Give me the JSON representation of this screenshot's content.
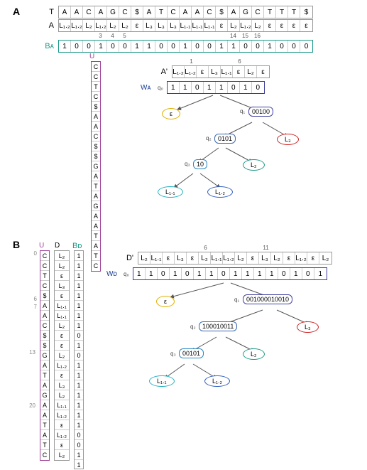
{
  "panelA": {
    "label": "A",
    "rows": {
      "T": {
        "label": "T",
        "cells": [
          "A",
          "A",
          "C",
          "A",
          "G",
          "C",
          "$",
          "A",
          "T",
          "C",
          "A",
          "A",
          "C",
          "$",
          "A",
          "G",
          "C",
          "T",
          "T",
          "T",
          "$"
        ]
      },
      "A": {
        "label": "A",
        "cells": [
          "L₁.₂",
          "L₁.₂",
          "L₂",
          "L₁.₂",
          "L₂",
          "L₂",
          "ε",
          "L₃",
          "L₃",
          "L₃",
          "L₁.₁",
          "L₁.₁",
          "L₁.₁",
          "ε",
          "L₂",
          "L₁.₂",
          "L₂",
          "ε",
          "ε",
          "ε",
          "ε"
        ]
      },
      "BA": {
        "label": "Bᴀ",
        "indices_top": [
          "",
          "",
          "",
          "3",
          "4",
          "5",
          "",
          "",
          "",
          "",
          "",
          "",
          "",
          "",
          "14",
          "15",
          "16",
          "",
          "",
          "",
          ""
        ],
        "cells": [
          "1",
          "0",
          "0",
          "1",
          "0",
          "0",
          "1",
          "1",
          "0",
          "0",
          "1",
          "0",
          "0",
          "1",
          "1",
          "0",
          "0",
          "1",
          "0",
          "0",
          "0"
        ]
      }
    },
    "U": {
      "label": "U",
      "cells": [
        "C",
        "C",
        "T",
        "C",
        "$",
        "A",
        "A",
        "C",
        "$",
        "$",
        "G",
        "A",
        "T",
        "A",
        "G",
        "A",
        "A",
        "T",
        "A",
        "T",
        "C"
      ]
    },
    "Aprime": {
      "label": "A'",
      "indices": [
        "",
        "1",
        "",
        "",
        "",
        "6",
        "",
        ""
      ],
      "cells": [
        "L₁.₂",
        "L₁.₂",
        "ε",
        "L₃",
        "L₁.₁",
        "ε",
        "L₂",
        "ε"
      ]
    },
    "WA": {
      "label": "Wᴀ",
      "cells": [
        "1",
        "1",
        "0",
        "1",
        "1",
        "0",
        "1",
        "0"
      ]
    },
    "tree": {
      "q0": "q₀",
      "q1": "q₁",
      "q2": "q₂",
      "q3": "q₃",
      "eps": "ε",
      "n1": "00100",
      "n2": "0101",
      "n3": "10",
      "L3": "L₃",
      "L2": "L₂",
      "L11": "L₁.₁",
      "L12": "L₁.₂"
    }
  },
  "panelB": {
    "label": "B",
    "U": {
      "label": "U",
      "indices": {
        "0": "0",
        "6": "6",
        "7": "7",
        "13": "13",
        "20": "20"
      },
      "cells": [
        "C",
        "C",
        "T",
        "C",
        "$",
        "A",
        "A",
        "C",
        "$",
        "$",
        "G",
        "A",
        "T",
        "A",
        "G",
        "A",
        "A",
        "T",
        "A",
        "T",
        "C"
      ]
    },
    "D": {
      "label": "D",
      "cells": [
        "L₂",
        "L₂",
        "ε",
        "L₃",
        "ε",
        "L₁.₁",
        "L₁.₁",
        "L₂",
        "ε",
        "ε",
        "L₂",
        "L₁.₂",
        "ε",
        "L₃",
        "L₂",
        "L₁.₁",
        "L₁.₂",
        "ε",
        "L₁.₂",
        "ε",
        "L₂"
      ]
    },
    "BD": {
      "label": "Bᴅ",
      "cells": [
        "1",
        "1",
        "1",
        "1",
        "1",
        "1",
        "1",
        "1",
        "0",
        "1",
        "0",
        "1",
        "1",
        "1",
        "1",
        "1",
        "1",
        "1",
        "0",
        "0",
        "1",
        "1"
      ]
    },
    "Dprime": {
      "label": "D'",
      "indices": [
        "",
        "",
        "",
        "",
        "",
        "6",
        "",
        "",
        "",
        "",
        "11",
        "",
        "",
        "",
        "",
        ""
      ],
      "cells": [
        "L₂",
        "L₁.₁",
        "ε",
        "L₃",
        "ε",
        "L₂",
        "L₁.₁",
        "L₁.₂",
        "L₂",
        "ε",
        "L₃",
        "L₂",
        "ε",
        "L₁.₂",
        "ε",
        "L₂"
      ]
    },
    "WD": {
      "label": "Wᴅ",
      "cells": [
        "1",
        "1",
        "0",
        "1",
        "0",
        "1",
        "1",
        "0",
        "1",
        "1",
        "1",
        "1",
        "0",
        "1",
        "0",
        "1"
      ]
    },
    "tree": {
      "q0": "q₀",
      "q1": "q₁",
      "q2": "q₂",
      "q3": "q₃",
      "eps": "ε",
      "n1": "001000010010",
      "n2": "100010011",
      "n3": "00101",
      "L3": "L₃",
      "L2": "L₂",
      "L11": "L₁.₁",
      "L12": "L₁.₂"
    }
  }
}
